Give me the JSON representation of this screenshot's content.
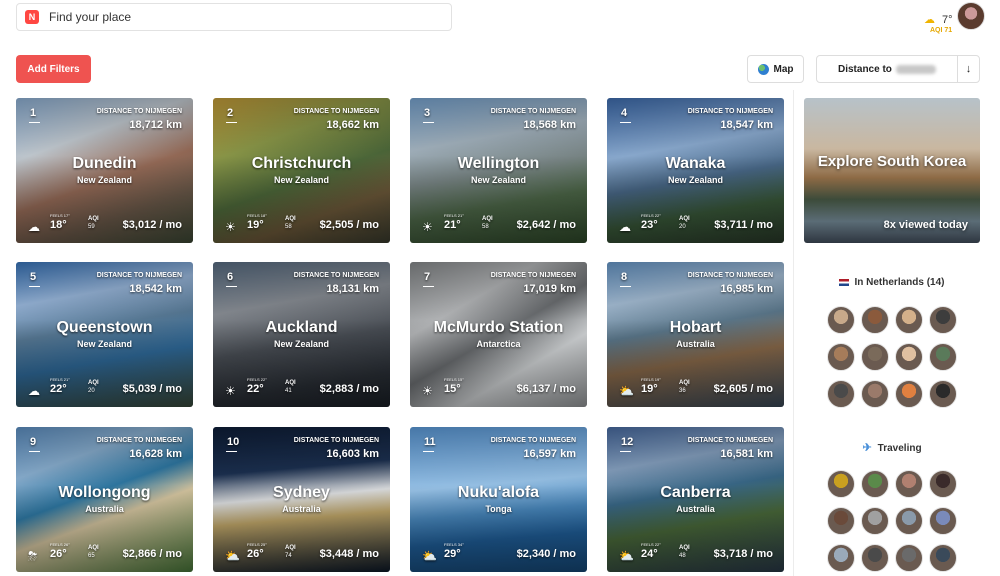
{
  "search": {
    "placeholder": "Find your place"
  },
  "header": {
    "weather_temp": "7°",
    "weather_aqi": "AQI 71",
    "weather_icon": "sun-cloud-icon"
  },
  "toolbar": {
    "filters_label": "Add Filters",
    "map_label": "Map",
    "sort_label": "Distance to",
    "sort_arrow": "↓"
  },
  "cities": [
    {
      "rank": "1",
      "dist_label": "DISTANCE TO NIJMEGEN",
      "distance": "18,712 km",
      "name": "Dunedin",
      "country": "New Zealand",
      "cond": "☁",
      "feels": "FEELS 17°",
      "temp": "18°",
      "aqi_label": "AQI",
      "aqi": "59",
      "cost": "$3,012 / mo",
      "bg": "linear-gradient(160deg,#8fb3d9 0%,#c7cfd6 30%,#9a6e5a 55%,#6b5a4a 75%,#3e4a36 100%)"
    },
    {
      "rank": "2",
      "dist_label": "DISTANCE TO NIJMEGEN",
      "distance": "18,662 km",
      "name": "Christchurch",
      "country": "New Zealand",
      "cond": "☀",
      "feels": "FEELS 18°",
      "temp": "19°",
      "aqi_label": "AQI",
      "aqi": "58",
      "cost": "$2,505 / mo",
      "bg": "linear-gradient(160deg,#c9a03a 0%,#8e9b4a 30%,#4f6b3b 55%,#6e5a3a 75%,#3a3c2e 100%)"
    },
    {
      "rank": "3",
      "dist_label": "DISTANCE TO NIJMEGEN",
      "distance": "18,568 km",
      "name": "Wellington",
      "country": "New Zealand",
      "cond": "☀",
      "feels": "FEELS 21°",
      "temp": "21°",
      "aqi_label": "AQI",
      "aqi": "58",
      "cost": "$2,642 / mo",
      "bg": "linear-gradient(170deg,#7aa8d6 0%,#a8b8c4 30%,#7d8a8a 50%,#4f6a4a 70%,#2f4a2a 100%)"
    },
    {
      "rank": "4",
      "dist_label": "DISTANCE TO NIJMEGEN",
      "distance": "18,547 km",
      "name": "Wanaka",
      "country": "New Zealand",
      "cond": "☁",
      "feels": "FEELS 22°",
      "temp": "23°",
      "aqi_label": "AQI",
      "aqi": "20",
      "cost": "$3,711 / mo",
      "bg": "linear-gradient(170deg,#3f6fb3 0%,#8fb0d6 35%,#4a6a8a 55%,#3a5a3a 75%,#2a3a2a 100%)"
    },
    {
      "rank": "5",
      "dist_label": "DISTANCE TO NIJMEGEN",
      "distance": "18,542 km",
      "name": "Queenstown",
      "country": "New Zealand",
      "cond": "☁",
      "feels": "FEELS 21°",
      "temp": "22°",
      "aqi_label": "AQI",
      "aqi": "20",
      "cost": "$5,039 / mo",
      "bg": "linear-gradient(170deg,#3a78c0 0%,#9cbbe0 25%,#5a7d9a 45%,#2f6a9a 65%,#3a4a3a 100%)"
    },
    {
      "rank": "6",
      "dist_label": "DISTANCE TO NIJMEGEN",
      "distance": "18,131 km",
      "name": "Auckland",
      "country": "New Zealand",
      "cond": "☀",
      "feels": "FEELS 22°",
      "temp": "22°",
      "aqi_label": "AQI",
      "aqi": "41",
      "cost": "$2,883 / mo",
      "bg": "linear-gradient(170deg,#5a6f86 0%,#8a8f96 30%,#4a4f56 55%,#2a2f36 80%,#1a1f26 100%)"
    },
    {
      "rank": "7",
      "dist_label": "DISTANCE TO NIJMEGEN",
      "distance": "17,019 km",
      "name": "McMurdo Station",
      "country": "Antarctica",
      "cond": "☀",
      "feels": "FEELS 15°",
      "temp": "15°",
      "aqi_label": "",
      "aqi": "",
      "cost": "$6,137 / mo",
      "bg": "linear-gradient(150deg,#8a8d8f 0%,#b9bbbd 30%,#6d7073 50%,#d9dcde 70%,#9a9d9f 100%)"
    },
    {
      "rank": "8",
      "dist_label": "DISTANCE TO NIJMEGEN",
      "distance": "16,985 km",
      "name": "Hobart",
      "country": "Australia",
      "cond": "⛅",
      "feels": "FEELS 19°",
      "temp": "19°",
      "aqi_label": "AQI",
      "aqi": "36",
      "cost": "$2,605 / mo",
      "bg": "linear-gradient(170deg,#6a9ccf 0%,#a9c2da 25%,#5d7a8e 45%,#8a6a4a 65%,#3a4a5a 100%)"
    },
    {
      "rank": "9",
      "dist_label": "DISTANCE TO NIJMEGEN",
      "distance": "16,628 km",
      "name": "Wollongong",
      "country": "Australia",
      "cond": "⛈",
      "feels": "FEELS 26°",
      "temp": "26°",
      "aqi_label": "AQI",
      "aqi": "65",
      "cost": "$2,866 / mo",
      "bg": "linear-gradient(160deg,#5f93c8 0%,#8db4d6 25%,#2f7aa6 45%,#d9c9a3 60%,#4a7a3a 100%)"
    },
    {
      "rank": "10",
      "dist_label": "DISTANCE TO NIJMEGEN",
      "distance": "16,603 km",
      "name": "Sydney",
      "country": "Australia",
      "cond": "⛅",
      "feels": "FEELS 25°",
      "temp": "26°",
      "aqi_label": "AQI",
      "aqi": "74",
      "cost": "$3,448 / mo",
      "bg": "linear-gradient(175deg,#0f1f3a 0%,#1c3152 30%,#e2e4e6 48%,#c2a86a 62%,#0c1828 100%)"
    },
    {
      "rank": "11",
      "dist_label": "DISTANCE TO NIJMEGEN",
      "distance": "16,597 km",
      "name": "Nuku'alofa",
      "country": "Tonga",
      "cond": "⛅",
      "feels": "FEELS 34°",
      "temp": "29°",
      "aqi_label": "",
      "aqi": "",
      "cost": "$2,340 / mo",
      "bg": "linear-gradient(175deg,#5e9fe0 0%,#9cc8ee 40%,#4a8ac0 58%,#1f5e99 75%,#164a7a 100%)"
    },
    {
      "rank": "12",
      "dist_label": "DISTANCE TO NIJMEGEN",
      "distance": "16,581 km",
      "name": "Canberra",
      "country": "Australia",
      "cond": "⛅",
      "feels": "FEELS 22°",
      "temp": "24°",
      "aqi_label": "AQI",
      "aqi": "48",
      "cost": "$3,718 / mo",
      "bg": "linear-gradient(170deg,#4a6ea6 0%,#8aa6c6 25%,#3a6a8a 45%,#4a6a3a 65%,#2a3a4a 100%)"
    }
  ],
  "promo": {
    "title": "Explore South Korea",
    "views": "8x viewed today"
  },
  "netherlands": {
    "title": "In Netherlands (14)"
  },
  "traveling": {
    "title": "Traveling"
  },
  "avatar_colors": [
    "#c8a98a",
    "#8b5a3c",
    "#d4b08a",
    "#3d3d3d",
    "#a67c5a",
    "#7a6a5a",
    "#e0c0a0",
    "#5a7a5a",
    "#4a4a4a",
    "#9a7a6a",
    "#e08040",
    "#2a2a2a",
    "#c9a020",
    "#5a8a4a",
    "#b08070",
    "#3a2a2a",
    "#6a4a3a",
    "#a0a0a0",
    "#8a9aaa",
    "#7a8aba",
    "#9aaaba",
    "#4a4a4a",
    "#6a6a6a",
    "#3a4a5a"
  ]
}
